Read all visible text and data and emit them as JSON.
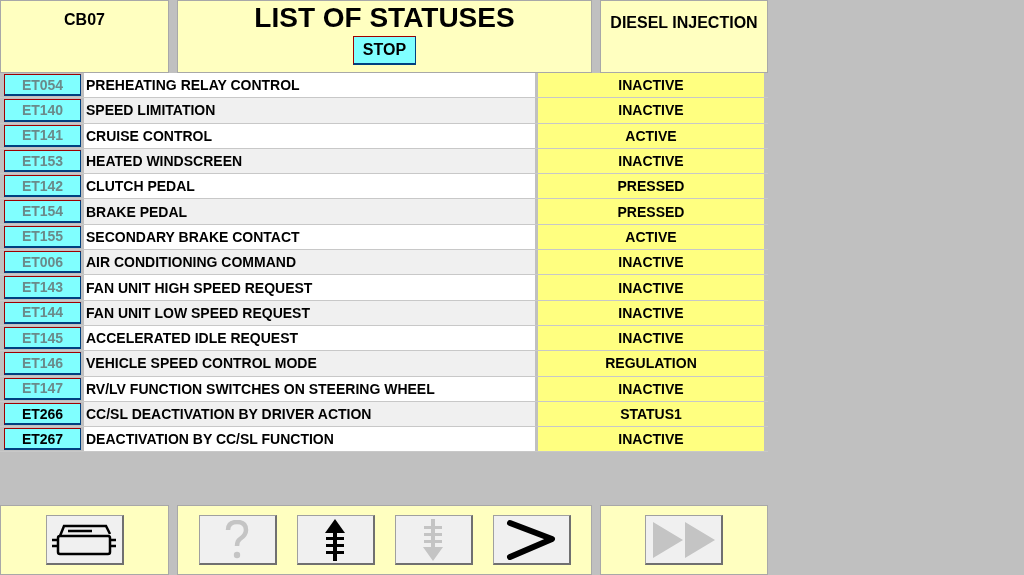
{
  "header": {
    "code": "CB07",
    "title": "LIST OF STATUSES",
    "stop_button": "STOP",
    "system": "DIESEL INJECTION"
  },
  "rows": [
    {
      "code": "ET054",
      "label": "PREHEATING RELAY CONTROL",
      "value": "INACTIVE",
      "disabled": true
    },
    {
      "code": "ET140",
      "label": "SPEED LIMITATION",
      "value": "INACTIVE",
      "disabled": true
    },
    {
      "code": "ET141",
      "label": "CRUISE CONTROL",
      "value": "ACTIVE",
      "disabled": true
    },
    {
      "code": "ET153",
      "label": "HEATED WINDSCREEN",
      "value": "INACTIVE",
      "disabled": true
    },
    {
      "code": "ET142",
      "label": "CLUTCH PEDAL",
      "value": "PRESSED",
      "disabled": true
    },
    {
      "code": "ET154",
      "label": "BRAKE PEDAL",
      "value": "PRESSED",
      "disabled": true
    },
    {
      "code": "ET155",
      "label": "SECONDARY BRAKE CONTACT",
      "value": "ACTIVE",
      "disabled": true
    },
    {
      "code": "ET006",
      "label": "AIR CONDITIONING COMMAND",
      "value": "INACTIVE",
      "disabled": true
    },
    {
      "code": "ET143",
      "label": "FAN UNIT HIGH SPEED REQUEST",
      "value": "INACTIVE",
      "disabled": true
    },
    {
      "code": "ET144",
      "label": "FAN UNIT LOW SPEED REQUEST",
      "value": "INACTIVE",
      "disabled": true
    },
    {
      "code": "ET145",
      "label": "ACCELERATED IDLE REQUEST",
      "value": "INACTIVE",
      "disabled": true
    },
    {
      "code": "ET146",
      "label": "VEHICLE SPEED CONTROL MODE",
      "value": "REGULATION",
      "disabled": true
    },
    {
      "code": "ET147",
      "label": "RV/LV FUNCTION SWITCHES ON STEERING WHEEL",
      "value": "INACTIVE",
      "disabled": true
    },
    {
      "code": "ET266",
      "label": "CC/SL DEACTIVATION BY DRIVER ACTION",
      "value": "STATUS1",
      "disabled": false
    },
    {
      "code": "ET267",
      "label": "DEACTIVATION BY CC/SL FUNCTION",
      "value": "INACTIVE",
      "disabled": false
    }
  ],
  "toolbar": {
    "left": [
      {
        "kind": "print",
        "disabled": false
      }
    ],
    "center": [
      {
        "kind": "help",
        "disabled": true
      },
      {
        "kind": "scroll-up",
        "disabled": false
      },
      {
        "kind": "scroll-down",
        "disabled": true
      },
      {
        "kind": "next",
        "disabled": false
      }
    ],
    "right": [
      {
        "kind": "fast-forward",
        "disabled": true
      }
    ]
  }
}
